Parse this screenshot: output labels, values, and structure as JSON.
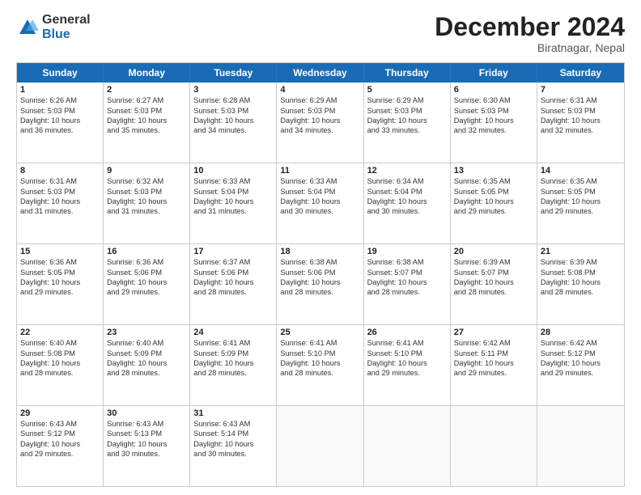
{
  "logo": {
    "general": "General",
    "blue": "Blue"
  },
  "title": "December 2024",
  "subtitle": "Biratnagar, Nepal",
  "header_days": [
    "Sunday",
    "Monday",
    "Tuesday",
    "Wednesday",
    "Thursday",
    "Friday",
    "Saturday"
  ],
  "weeks": [
    [
      {
        "day": "1",
        "lines": [
          "Sunrise: 6:26 AM",
          "Sunset: 5:03 PM",
          "Daylight: 10 hours",
          "and 36 minutes."
        ]
      },
      {
        "day": "2",
        "lines": [
          "Sunrise: 6:27 AM",
          "Sunset: 5:03 PM",
          "Daylight: 10 hours",
          "and 35 minutes."
        ]
      },
      {
        "day": "3",
        "lines": [
          "Sunrise: 6:28 AM",
          "Sunset: 5:03 PM",
          "Daylight: 10 hours",
          "and 34 minutes."
        ]
      },
      {
        "day": "4",
        "lines": [
          "Sunrise: 6:29 AM",
          "Sunset: 5:03 PM",
          "Daylight: 10 hours",
          "and 34 minutes."
        ]
      },
      {
        "day": "5",
        "lines": [
          "Sunrise: 6:29 AM",
          "Sunset: 5:03 PM",
          "Daylight: 10 hours",
          "and 33 minutes."
        ]
      },
      {
        "day": "6",
        "lines": [
          "Sunrise: 6:30 AM",
          "Sunset: 5:03 PM",
          "Daylight: 10 hours",
          "and 32 minutes."
        ]
      },
      {
        "day": "7",
        "lines": [
          "Sunrise: 6:31 AM",
          "Sunset: 5:03 PM",
          "Daylight: 10 hours",
          "and 32 minutes."
        ]
      }
    ],
    [
      {
        "day": "8",
        "lines": [
          "Sunrise: 6:31 AM",
          "Sunset: 5:03 PM",
          "Daylight: 10 hours",
          "and 31 minutes."
        ]
      },
      {
        "day": "9",
        "lines": [
          "Sunrise: 6:32 AM",
          "Sunset: 5:03 PM",
          "Daylight: 10 hours",
          "and 31 minutes."
        ]
      },
      {
        "day": "10",
        "lines": [
          "Sunrise: 6:33 AM",
          "Sunset: 5:04 PM",
          "Daylight: 10 hours",
          "and 31 minutes."
        ]
      },
      {
        "day": "11",
        "lines": [
          "Sunrise: 6:33 AM",
          "Sunset: 5:04 PM",
          "Daylight: 10 hours",
          "and 30 minutes."
        ]
      },
      {
        "day": "12",
        "lines": [
          "Sunrise: 6:34 AM",
          "Sunset: 5:04 PM",
          "Daylight: 10 hours",
          "and 30 minutes."
        ]
      },
      {
        "day": "13",
        "lines": [
          "Sunrise: 6:35 AM",
          "Sunset: 5:05 PM",
          "Daylight: 10 hours",
          "and 29 minutes."
        ]
      },
      {
        "day": "14",
        "lines": [
          "Sunrise: 6:35 AM",
          "Sunset: 5:05 PM",
          "Daylight: 10 hours",
          "and 29 minutes."
        ]
      }
    ],
    [
      {
        "day": "15",
        "lines": [
          "Sunrise: 6:36 AM",
          "Sunset: 5:05 PM",
          "Daylight: 10 hours",
          "and 29 minutes."
        ]
      },
      {
        "day": "16",
        "lines": [
          "Sunrise: 6:36 AM",
          "Sunset: 5:06 PM",
          "Daylight: 10 hours",
          "and 29 minutes."
        ]
      },
      {
        "day": "17",
        "lines": [
          "Sunrise: 6:37 AM",
          "Sunset: 5:06 PM",
          "Daylight: 10 hours",
          "and 28 minutes."
        ]
      },
      {
        "day": "18",
        "lines": [
          "Sunrise: 6:38 AM",
          "Sunset: 5:06 PM",
          "Daylight: 10 hours",
          "and 28 minutes."
        ]
      },
      {
        "day": "19",
        "lines": [
          "Sunrise: 6:38 AM",
          "Sunset: 5:07 PM",
          "Daylight: 10 hours",
          "and 28 minutes."
        ]
      },
      {
        "day": "20",
        "lines": [
          "Sunrise: 6:39 AM",
          "Sunset: 5:07 PM",
          "Daylight: 10 hours",
          "and 28 minutes."
        ]
      },
      {
        "day": "21",
        "lines": [
          "Sunrise: 6:39 AM",
          "Sunset: 5:08 PM",
          "Daylight: 10 hours",
          "and 28 minutes."
        ]
      }
    ],
    [
      {
        "day": "22",
        "lines": [
          "Sunrise: 6:40 AM",
          "Sunset: 5:08 PM",
          "Daylight: 10 hours",
          "and 28 minutes."
        ]
      },
      {
        "day": "23",
        "lines": [
          "Sunrise: 6:40 AM",
          "Sunset: 5:09 PM",
          "Daylight: 10 hours",
          "and 28 minutes."
        ]
      },
      {
        "day": "24",
        "lines": [
          "Sunrise: 6:41 AM",
          "Sunset: 5:09 PM",
          "Daylight: 10 hours",
          "and 28 minutes."
        ]
      },
      {
        "day": "25",
        "lines": [
          "Sunrise: 6:41 AM",
          "Sunset: 5:10 PM",
          "Daylight: 10 hours",
          "and 28 minutes."
        ]
      },
      {
        "day": "26",
        "lines": [
          "Sunrise: 6:41 AM",
          "Sunset: 5:10 PM",
          "Daylight: 10 hours",
          "and 29 minutes."
        ]
      },
      {
        "day": "27",
        "lines": [
          "Sunrise: 6:42 AM",
          "Sunset: 5:11 PM",
          "Daylight: 10 hours",
          "and 29 minutes."
        ]
      },
      {
        "day": "28",
        "lines": [
          "Sunrise: 6:42 AM",
          "Sunset: 5:12 PM",
          "Daylight: 10 hours",
          "and 29 minutes."
        ]
      }
    ],
    [
      {
        "day": "29",
        "lines": [
          "Sunrise: 6:43 AM",
          "Sunset: 5:12 PM",
          "Daylight: 10 hours",
          "and 29 minutes."
        ]
      },
      {
        "day": "30",
        "lines": [
          "Sunrise: 6:43 AM",
          "Sunset: 5:13 PM",
          "Daylight: 10 hours",
          "and 30 minutes."
        ]
      },
      {
        "day": "31",
        "lines": [
          "Sunrise: 6:43 AM",
          "Sunset: 5:14 PM",
          "Daylight: 10 hours",
          "and 30 minutes."
        ]
      },
      null,
      null,
      null,
      null
    ]
  ]
}
